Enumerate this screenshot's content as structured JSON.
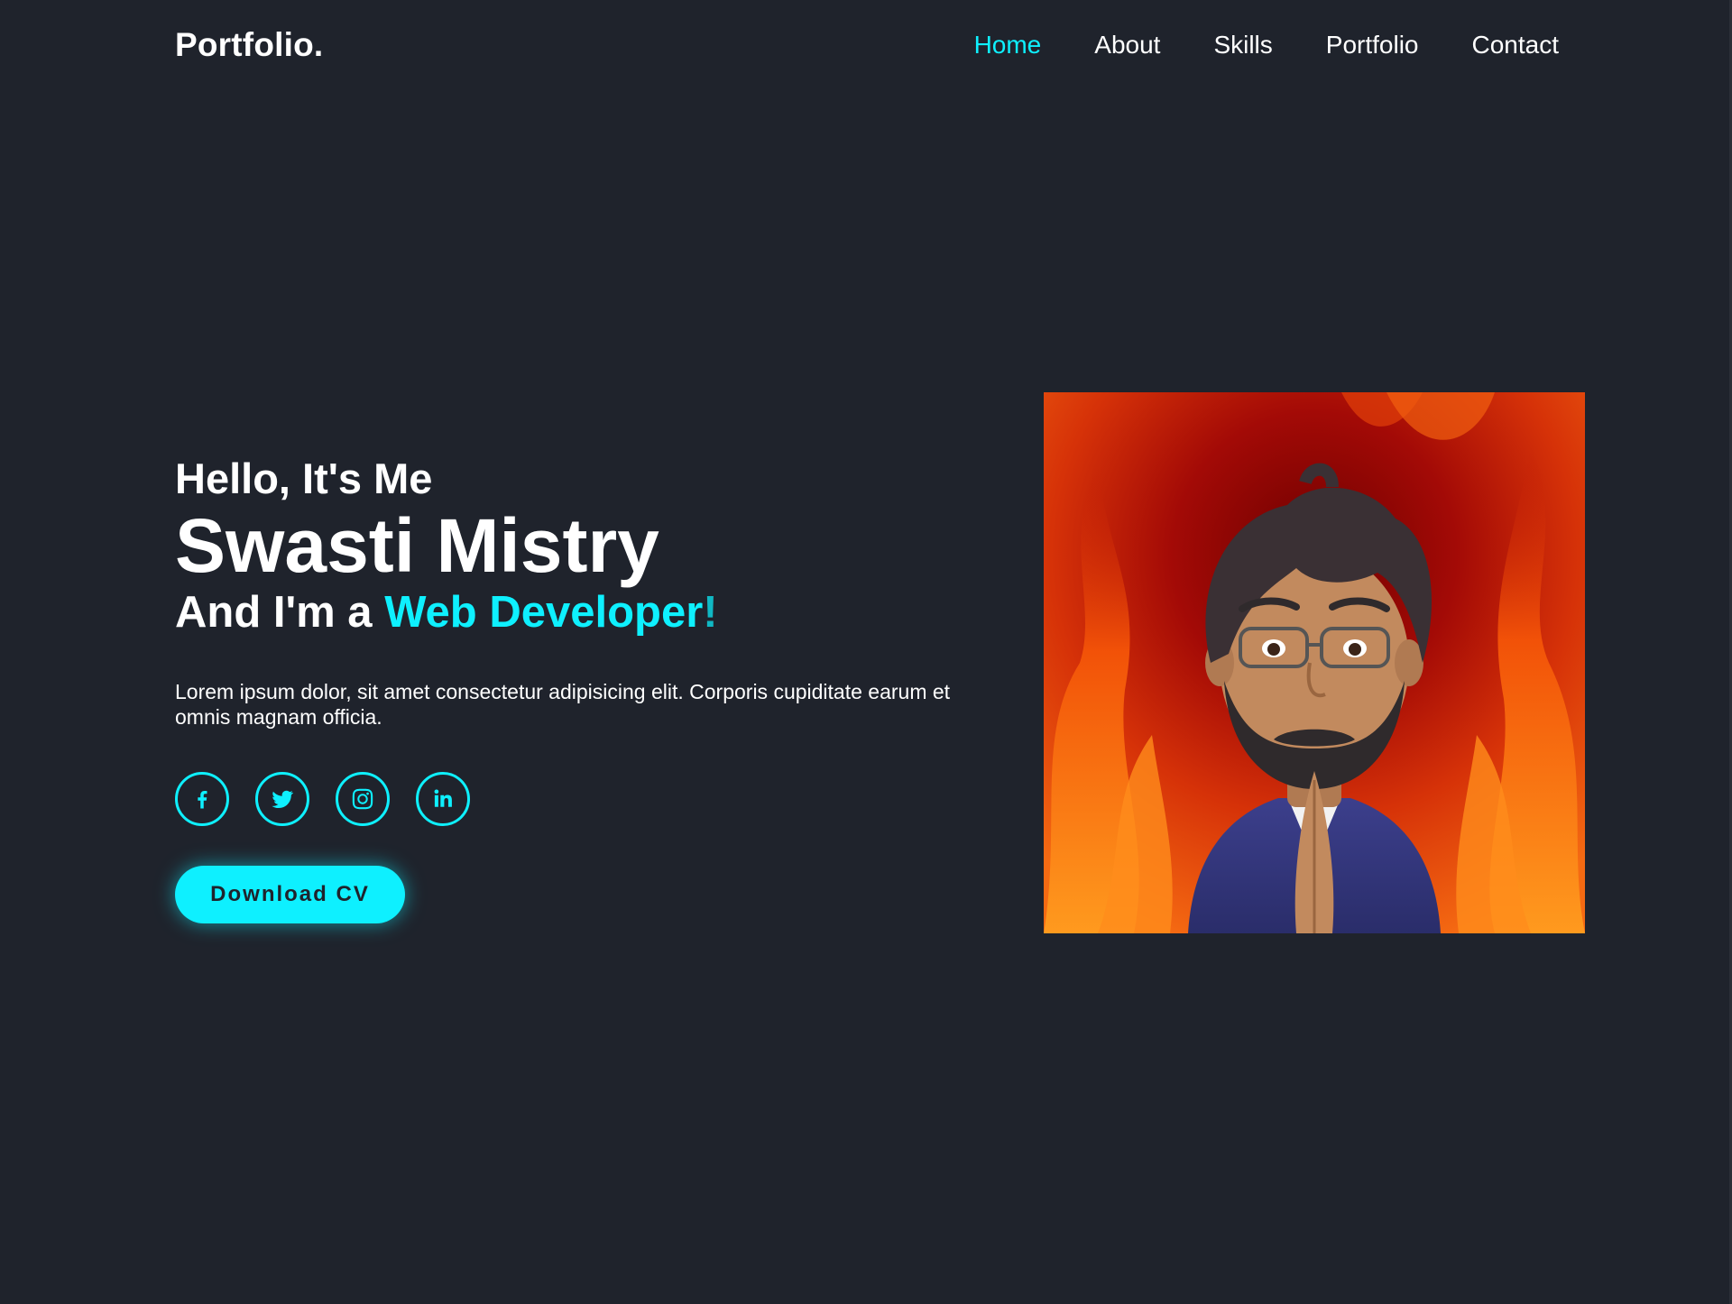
{
  "header": {
    "logo": "Portfolio.",
    "nav": [
      {
        "label": "Home",
        "active": true
      },
      {
        "label": "About",
        "active": false
      },
      {
        "label": "Skills",
        "active": false
      },
      {
        "label": "Portfolio",
        "active": false
      },
      {
        "label": "Contact",
        "active": false
      }
    ]
  },
  "hero": {
    "greeting": "Hello, It's Me",
    "name": "Swasti Mistry",
    "role_prefix": "And I'm a ",
    "role_accent": "Web Developer",
    "role_suffix": "!",
    "description": "Lorem ipsum dolor, sit amet consectetur adipisicing elit. Corporis cupiditate earum et omnis magnam officia.",
    "socials": [
      {
        "icon": "facebook-icon"
      },
      {
        "icon": "twitter-icon"
      },
      {
        "icon": "instagram-icon"
      },
      {
        "icon": "linkedin-icon"
      }
    ],
    "cta_label": "Download CV"
  },
  "avatar": {
    "description_icon": "avatar-image"
  },
  "colors": {
    "background": "#1f232c",
    "accent": "#0ef0ff",
    "text": "#ffffff"
  }
}
